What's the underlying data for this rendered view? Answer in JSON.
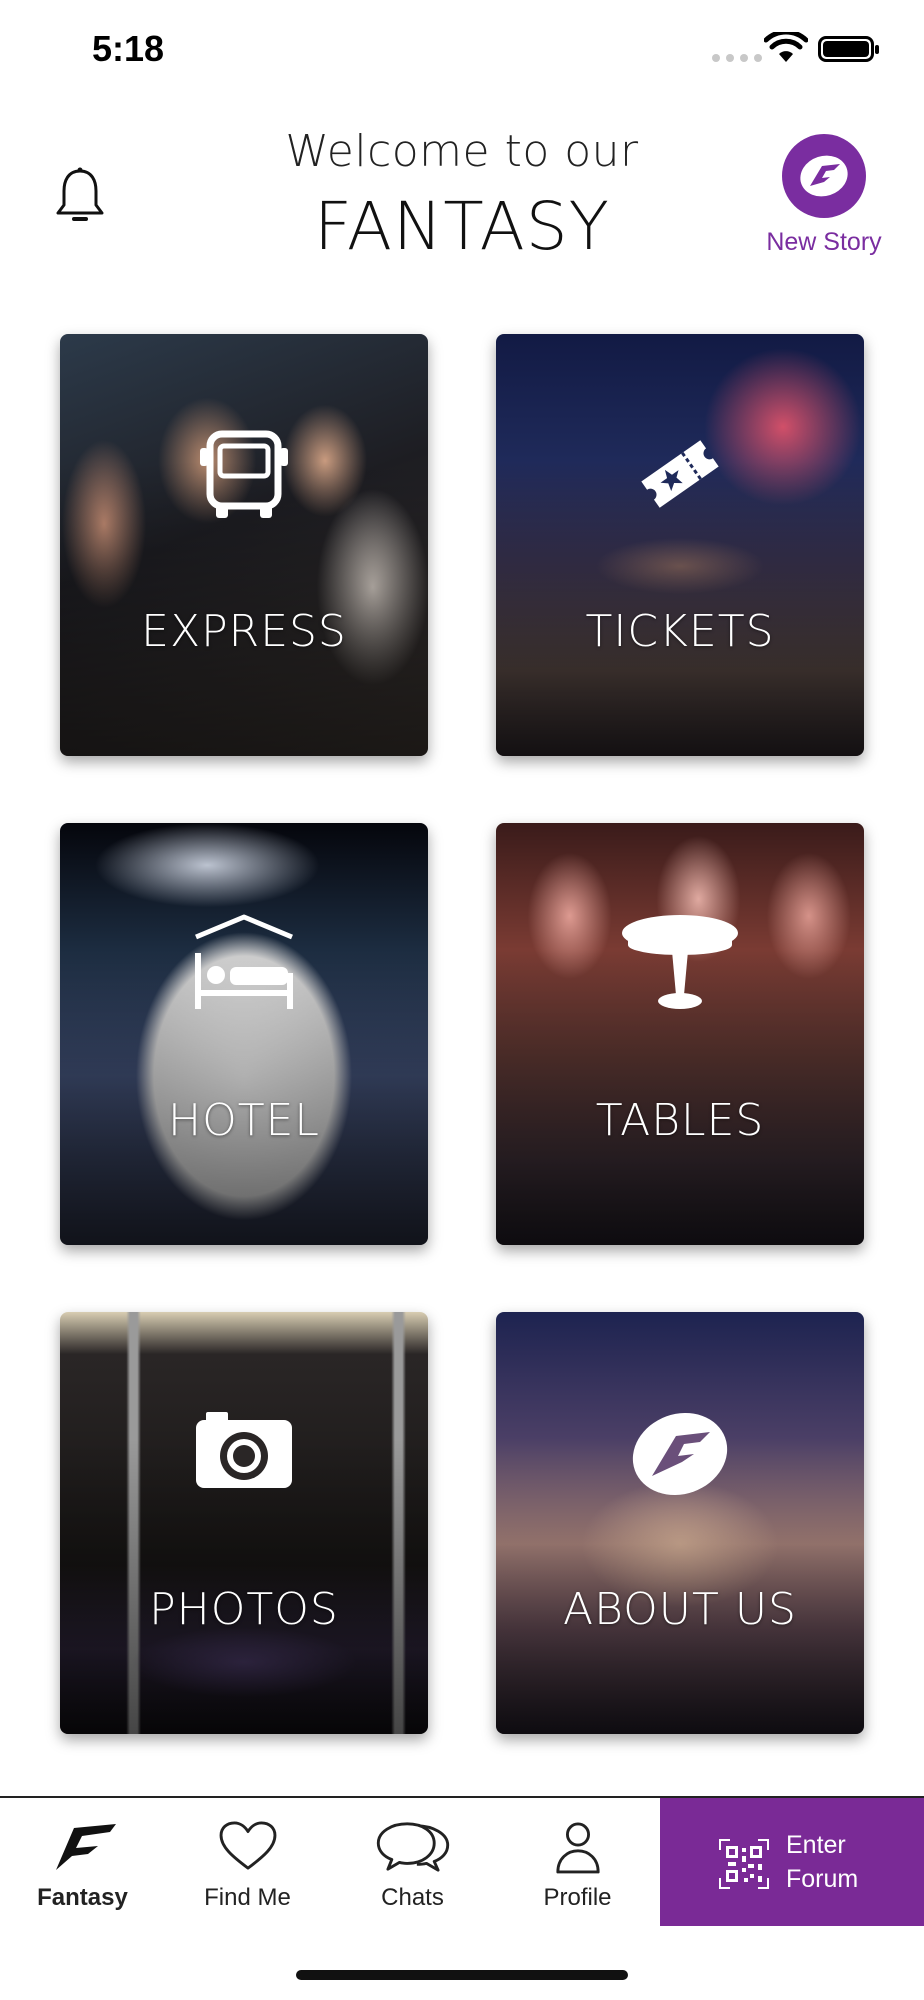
{
  "status_bar": {
    "time": "5:18"
  },
  "header": {
    "welcome": "Welcome to our",
    "title": "FANTASY",
    "new_story_label": "New Story"
  },
  "colors": {
    "brand_purple": "#7a2da0",
    "forum_purple": "#7a2a96"
  },
  "cards": [
    {
      "label": "EXPRESS",
      "icon": "bus-icon"
    },
    {
      "label": "TICKETS",
      "icon": "ticket-icon"
    },
    {
      "label": "HOTEL",
      "icon": "bed-icon"
    },
    {
      "label": "TABLES",
      "icon": "table-icon"
    },
    {
      "label": "PHOTOS",
      "icon": "camera-icon"
    },
    {
      "label": "ABOUT US",
      "icon": "fantasy-logo-icon"
    }
  ],
  "tabbar": {
    "items": [
      {
        "label": "Fantasy",
        "icon": "fantasy-logo-icon",
        "active": true
      },
      {
        "label": "Find Me",
        "icon": "heart-icon",
        "active": false
      },
      {
        "label": "Chats",
        "icon": "chat-bubbles-icon",
        "active": false
      },
      {
        "label": "Profile",
        "icon": "person-icon",
        "active": false
      }
    ],
    "forum": {
      "line1": "Enter",
      "line2": "Forum",
      "icon": "qr-code-icon"
    }
  }
}
